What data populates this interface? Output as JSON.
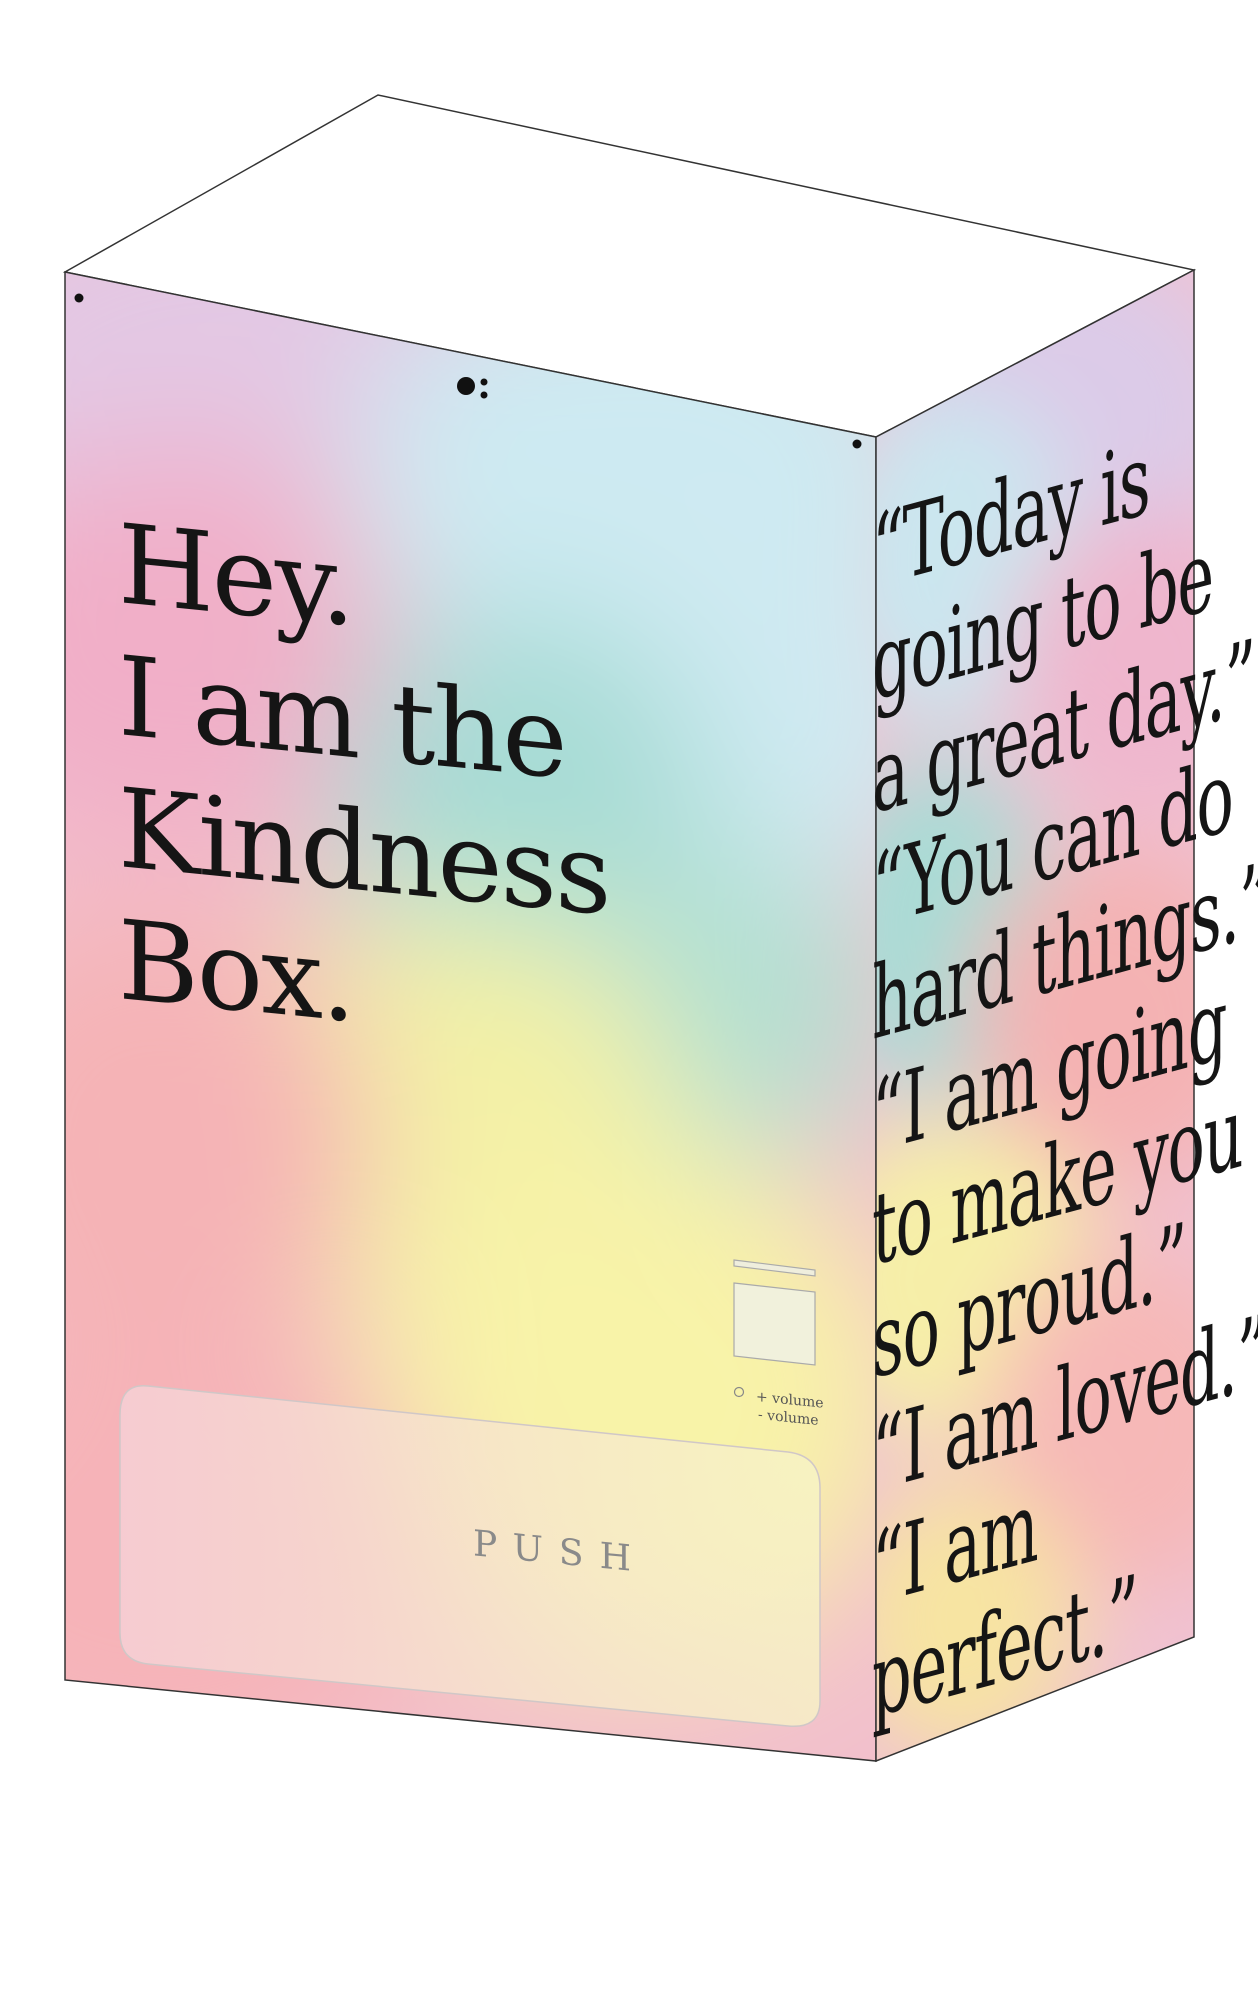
{
  "headline": [
    "Hey.",
    "I am the",
    "Kindness",
    "Box."
  ],
  "button": {
    "label": "PUSH"
  },
  "volume": {
    "up_label": "+ volume",
    "down_label": "- volume"
  },
  "side_quotes": [
    "“Today is",
    "going to be",
    "a great day.”",
    "“You can do",
    "hard things.”",
    "“I am going",
    "to make you",
    "so proud.”",
    "“I am loved.”",
    "“I am",
    "perfect.”"
  ],
  "icons": {
    "logo": "logo-dots-icon",
    "screw": "screw-dot-icon"
  },
  "colors": {
    "lavender": "#e3c7e3",
    "light_blue": "#cfeaf1",
    "teal": "#a9dcd6",
    "pink": "#f3b4c4",
    "yellow": "#f8f2a6",
    "coral": "#f4b0b2",
    "ink": "#151515",
    "outline": "#333333"
  }
}
